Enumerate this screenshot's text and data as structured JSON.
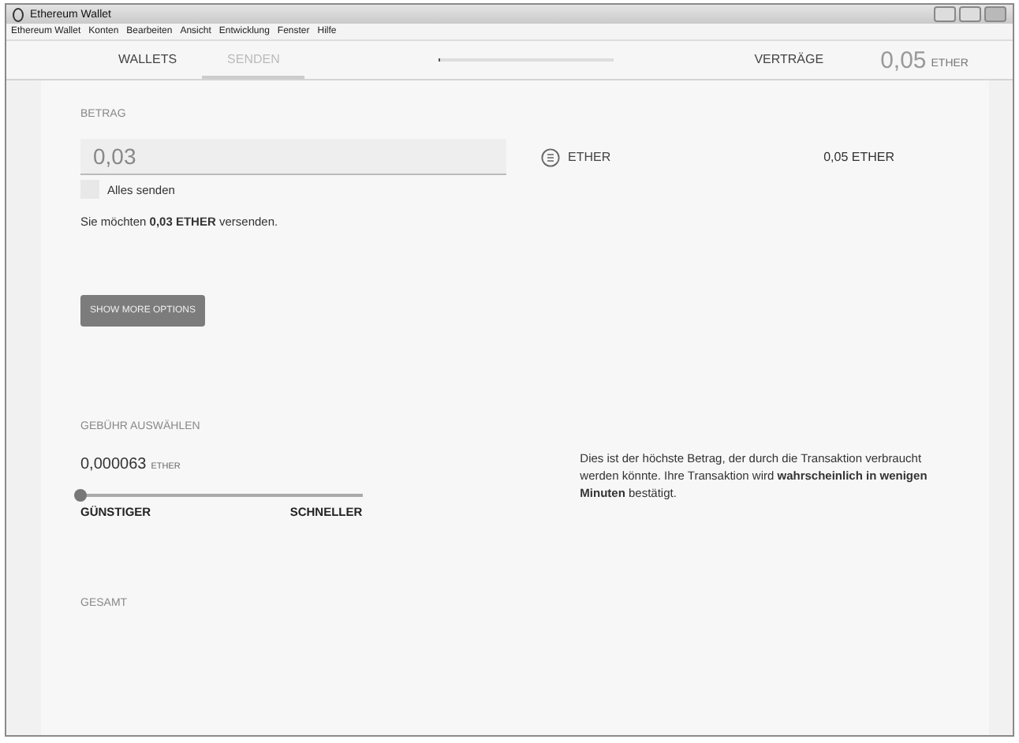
{
  "window": {
    "title": "Ethereum Wallet"
  },
  "menu": [
    "Ethereum Wallet",
    "Konten",
    "Bearbeiten",
    "Ansicht",
    "Entwicklung",
    "Fenster",
    "Hilfe"
  ],
  "nav": {
    "tabs": [
      {
        "label": "WALLETS",
        "selected": false
      },
      {
        "label": "SENDEN",
        "selected": true
      }
    ],
    "contracts": "VERTRÄGE",
    "balance": "0,05",
    "balance_unit": "ETHER"
  },
  "amount": {
    "label": "BETRAG",
    "value": "0,03",
    "unit": "ETHER",
    "available": "0,05 ETHER",
    "send_all": {
      "label": "Alles senden",
      "checked": false
    },
    "summary": "Sie möchten **0,03 ETHER** versenden."
  },
  "more_options": "SHOW MORE OPTIONS",
  "fee": {
    "label": "GEBÜHR AUSWÄHLEN",
    "value": "0,000063",
    "unit": "ETHER",
    "level": 0,
    "min_label": "GÜNSTIGER",
    "max_label": "SCHNELLER",
    "note": "Dies ist der höchste Betrag, der durch die Transaktion verbraucht werden könnte. Ihre Transaktion wird **wahrscheinlich in wenigen Minuten** bestätigt."
  },
  "total": {
    "label": "GESAMT"
  }
}
